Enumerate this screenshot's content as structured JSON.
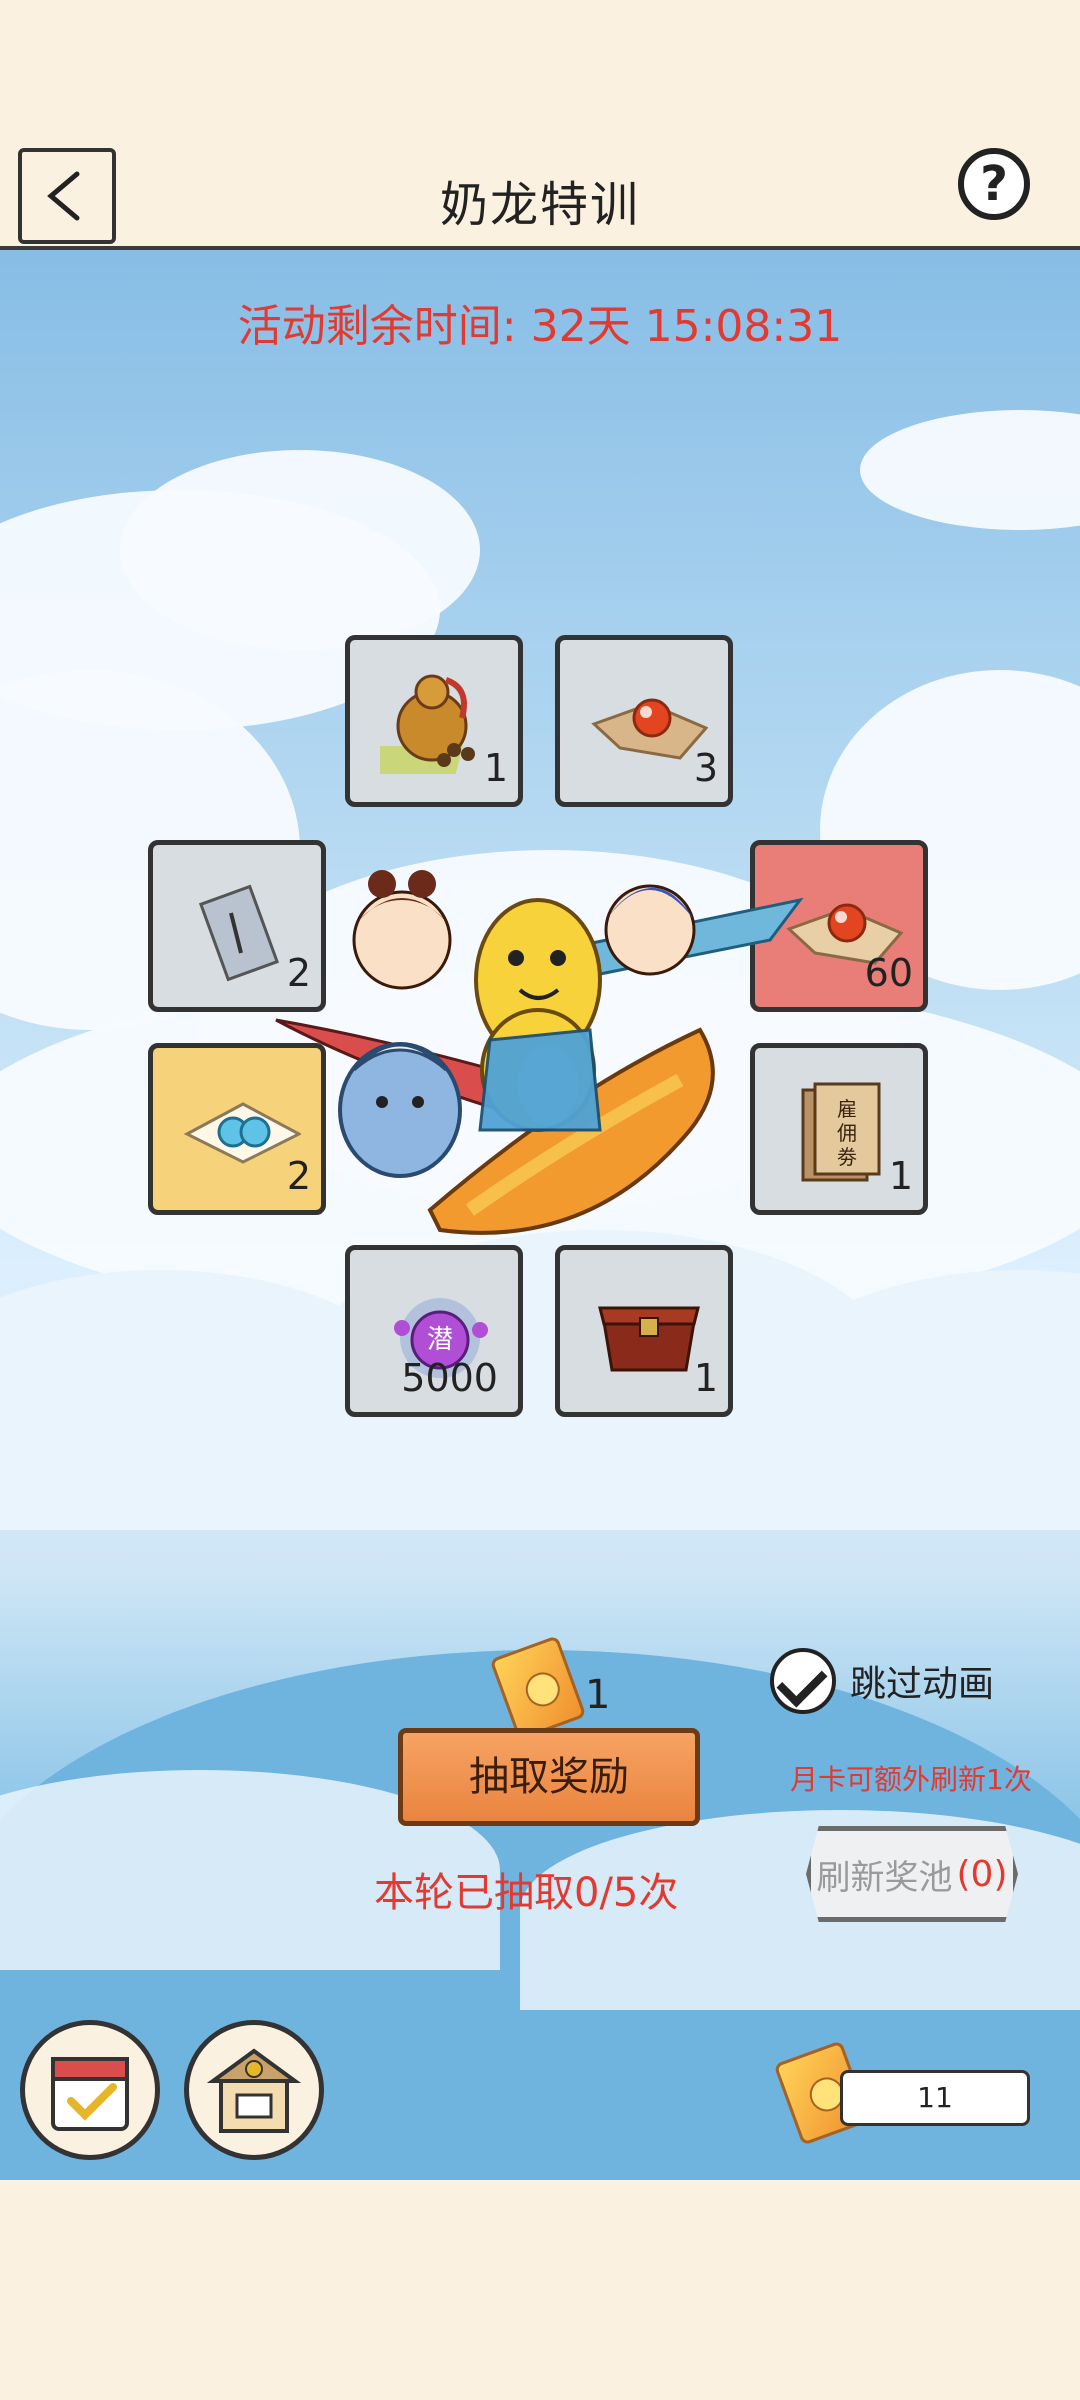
{
  "header": {
    "title": "奶龙特训"
  },
  "timer": {
    "label": "活动剩余时间:",
    "value": "32天 15:08:31"
  },
  "rewards": [
    {
      "icon": "gourd-icon",
      "qty": "1"
    },
    {
      "icon": "orb-on-carpet-icon",
      "qty": "3"
    },
    {
      "icon": "scroll-icon",
      "qty": "2"
    },
    {
      "icon": "orb-on-carpet-icon",
      "qty": "60"
    },
    {
      "icon": "pearl-envelope-icon",
      "qty": "2"
    },
    {
      "icon": "hire-ticket-icon",
      "qty": "1"
    },
    {
      "icon": "potential-orb-icon",
      "qty": "5000"
    },
    {
      "icon": "treasure-chest-icon",
      "qty": "1"
    }
  ],
  "draw": {
    "cost": "1",
    "button_label": "抽取奖励",
    "round_status": "本轮已抽取0/5次",
    "skip_label": "跳过动画",
    "monthly_note": "月卡可额外刷新1次",
    "refresh_label": "刷新奖池",
    "refresh_count": "(0)"
  },
  "balance": {
    "value": "11"
  },
  "colors": {
    "accent_red": "#e23a30",
    "button_orange": "#e9843f",
    "cream": "#fbf1e0"
  }
}
